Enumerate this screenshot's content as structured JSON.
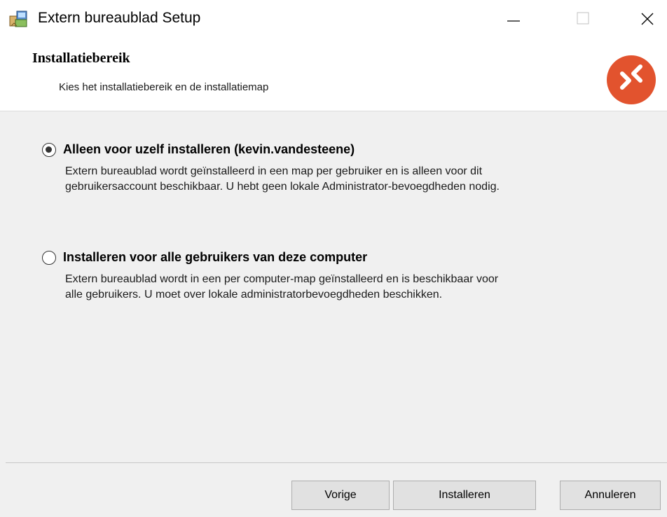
{
  "window": {
    "title": "Extern bureaublad Setup",
    "icons": [
      "setup-package-icon",
      "minimize-icon",
      "maximize-icon",
      "close-icon"
    ]
  },
  "header": {
    "title": "Installatiebereik",
    "subtitle": "Kies het installatiebereik en de installatiemap",
    "logo_color": "#e2532e"
  },
  "options": [
    {
      "label": "Alleen voor uzelf installeren (kevin.vandesteene)",
      "description_line1": "Extern bureaublad wordt geïnstalleerd in een map per gebruiker en is alleen voor dit",
      "description_line2": "gebruikersaccount beschikbaar. U hebt geen lokale Administrator-bevoegdheden nodig.",
      "selected": true
    },
    {
      "label": "Installeren voor alle gebruikers van deze computer",
      "description_line1": "Extern bureaublad wordt in een per computer-map geïnstalleerd en is beschikbaar voor",
      "description_line2": "alle gebruikers. U moet over lokale administratorbevoegdheden beschikken.",
      "selected": false
    }
  ],
  "buttons": {
    "back": "Vorige",
    "install": "Installeren",
    "cancel": "Annuleren"
  }
}
